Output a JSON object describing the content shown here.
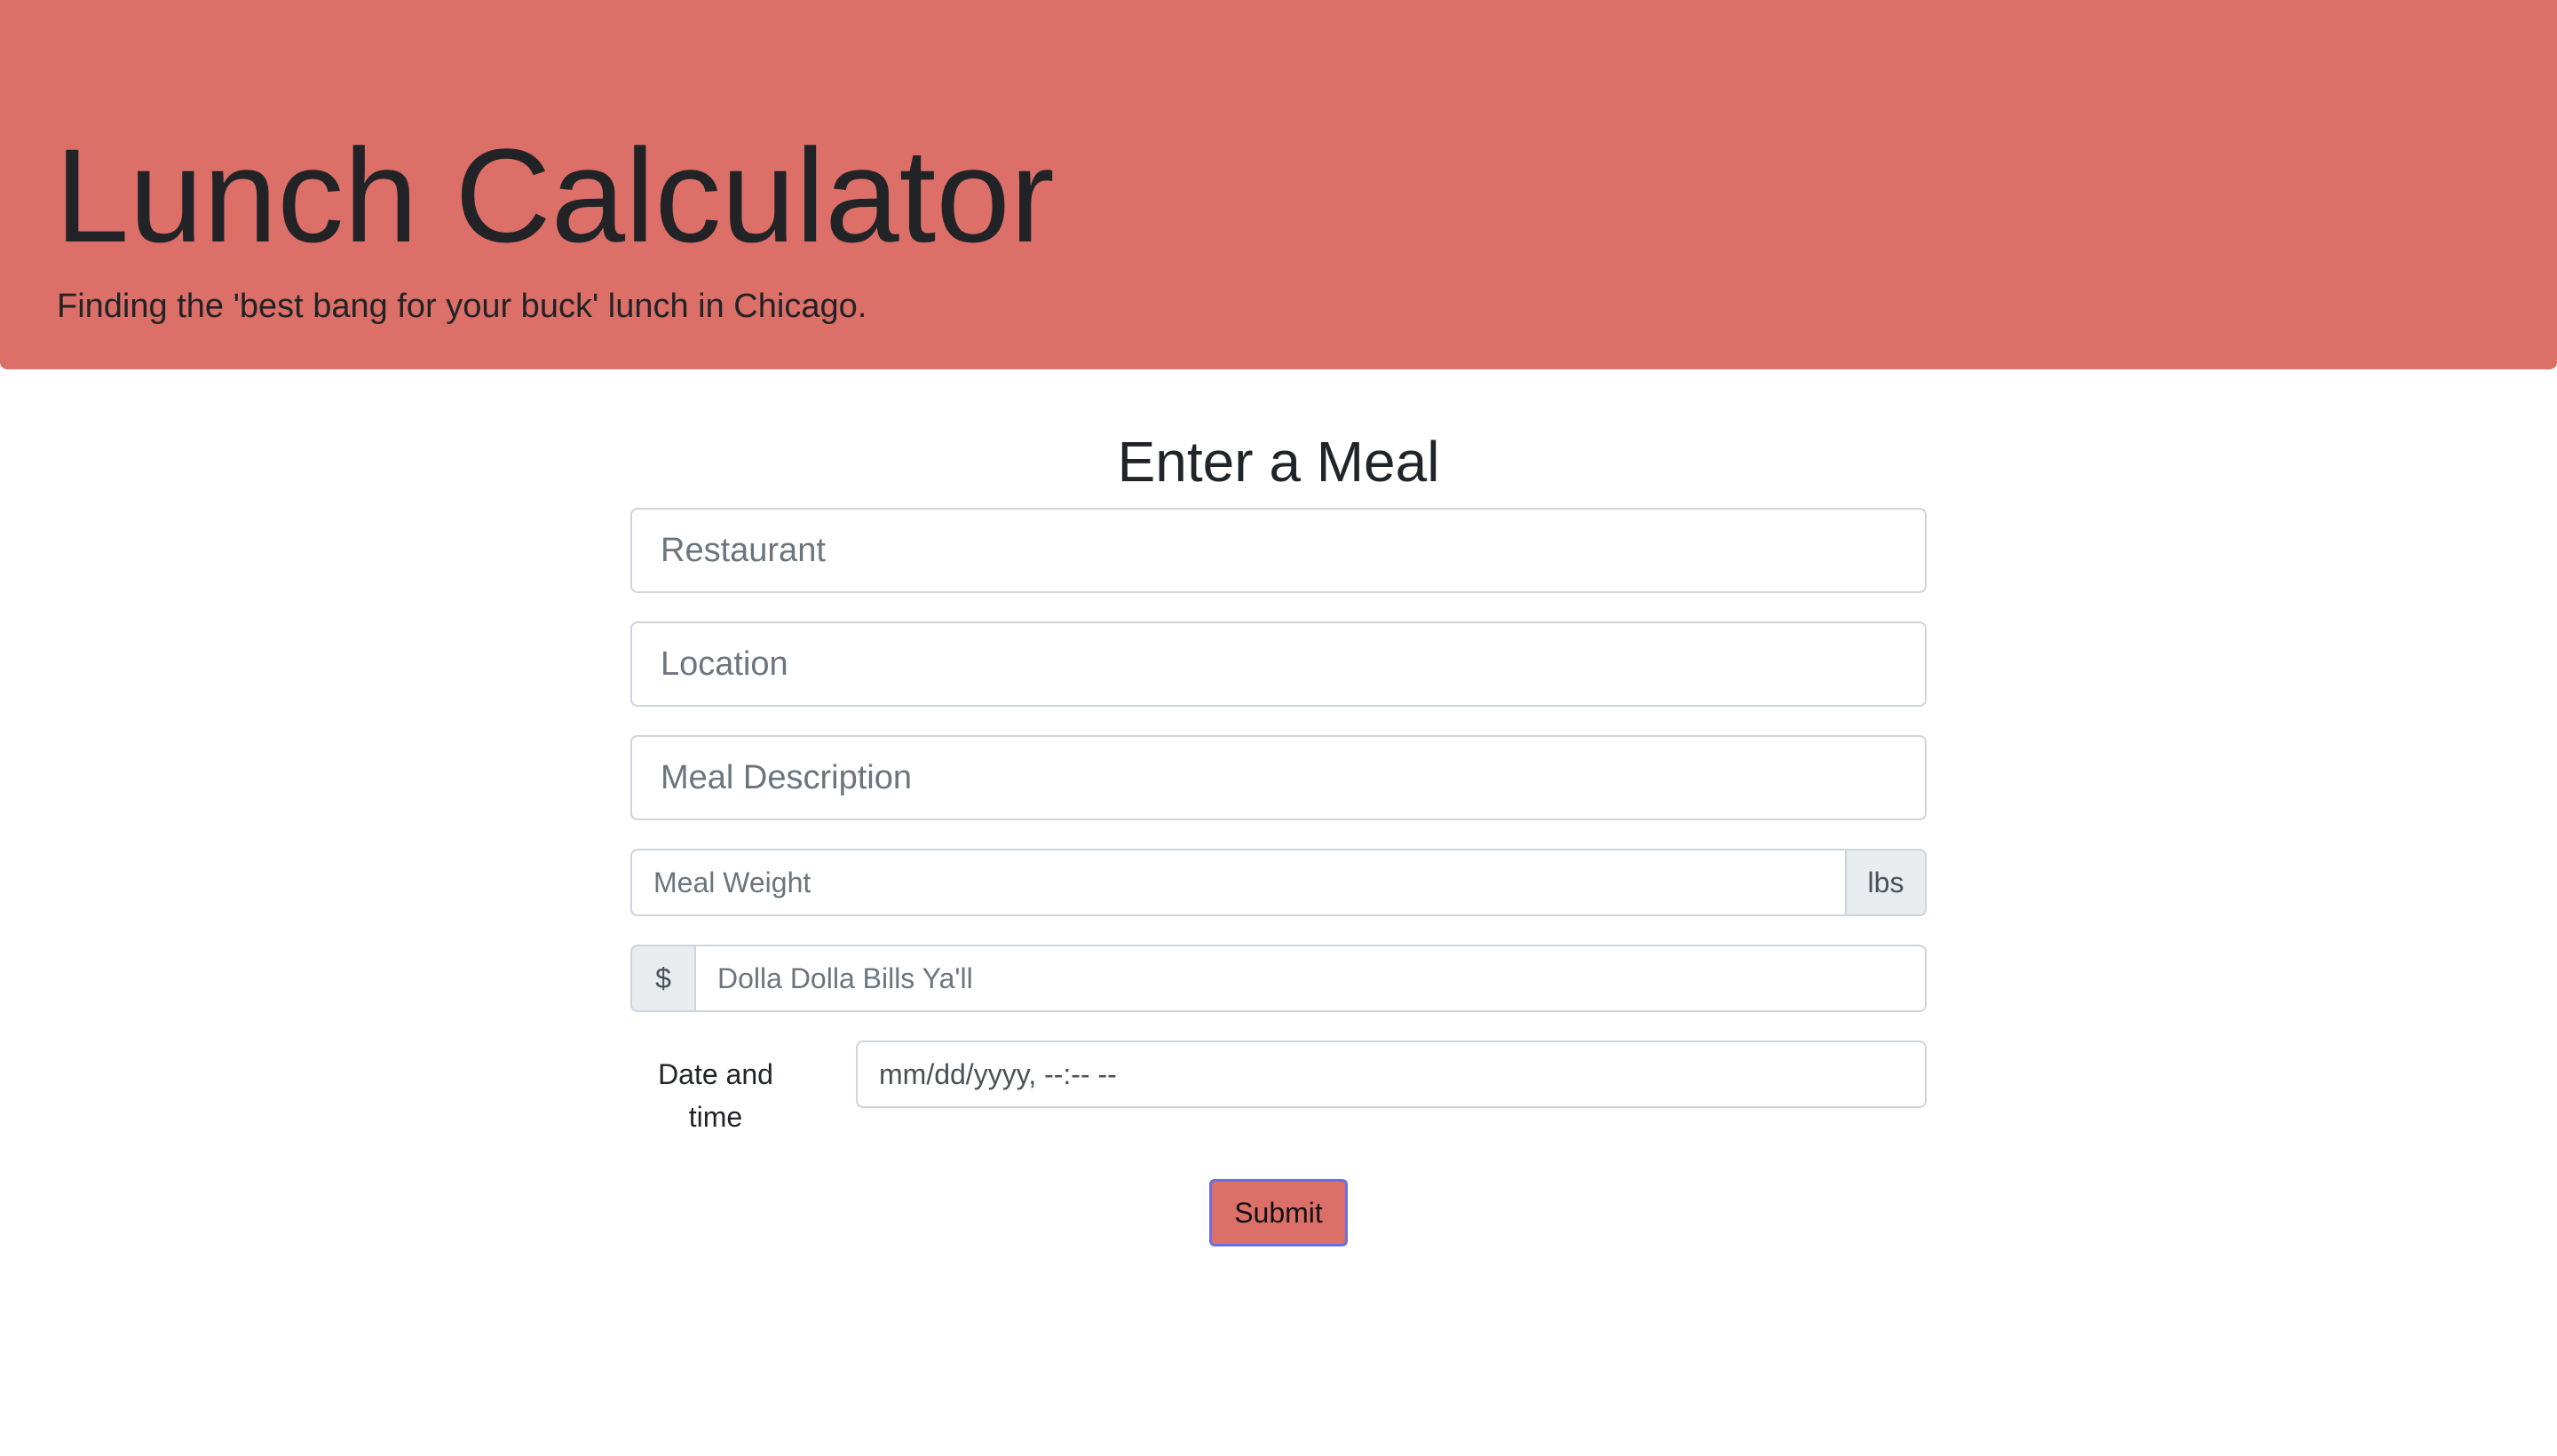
{
  "header": {
    "title": "Lunch Calculator",
    "subtitle": "Finding the 'best bang for your buck' lunch in Chicago."
  },
  "form": {
    "heading": "Enter a Meal",
    "restaurant_placeholder": "Restaurant",
    "location_placeholder": "Location",
    "description_placeholder": "Meal Description",
    "weight_placeholder": "Meal Weight",
    "weight_unit": "lbs",
    "price_prefix": "$",
    "price_placeholder": "Dolla Dolla Bills Ya'll",
    "date_label": "Date and time",
    "date_placeholder": "mm/dd/yyyy, --:-- --",
    "submit_label": "Submit"
  },
  "colors": {
    "accent": "#dc7069",
    "focus_ring": "#6b6ee0"
  }
}
